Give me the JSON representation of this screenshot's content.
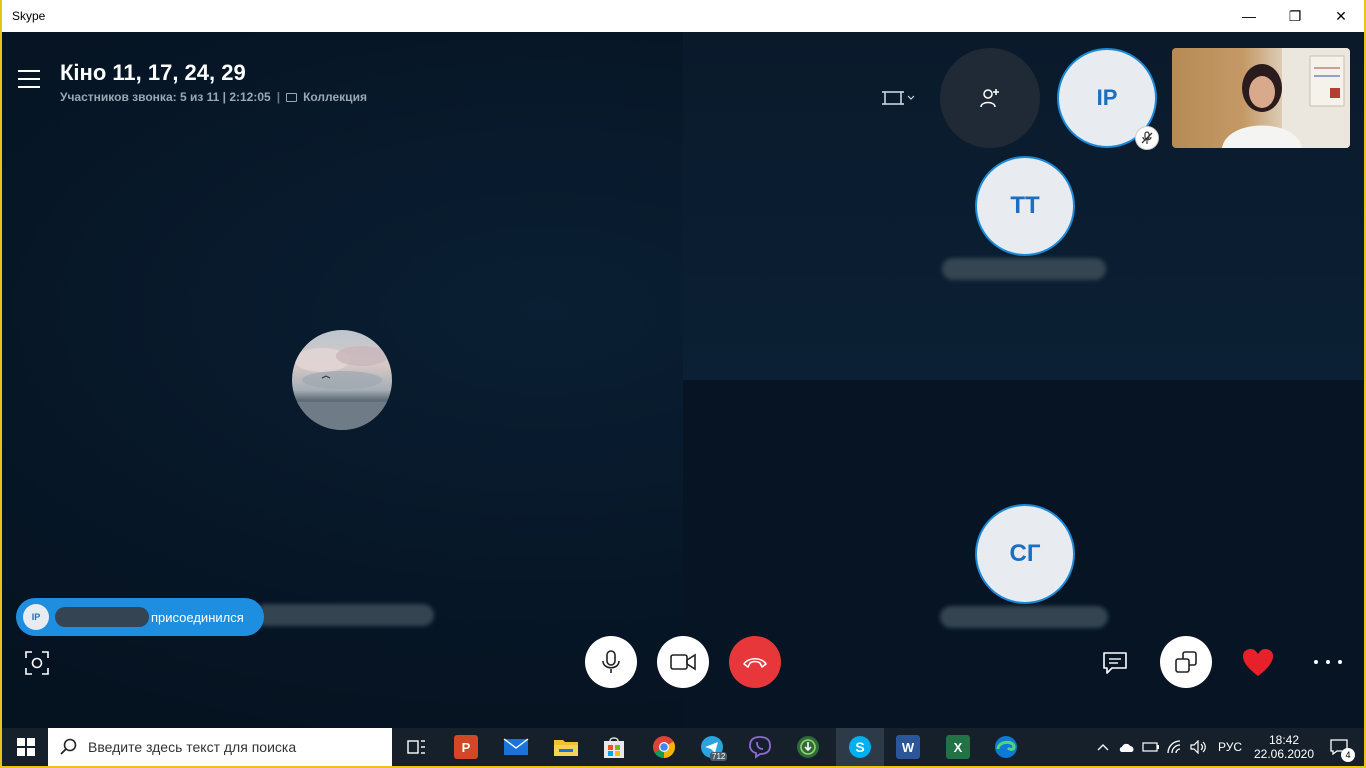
{
  "window": {
    "title": "Skype",
    "minimize": "—",
    "restore": "❐",
    "close": "✕"
  },
  "call": {
    "title": "Кіно 11, 17, 24, 29",
    "participants": "Участников звонка: 5 из 11 | 2:12:05",
    "separator": "|",
    "collection": "Коллекция"
  },
  "participants": [
    {
      "initials": "IP",
      "muted": true
    },
    {
      "initials": "TT"
    },
    {
      "initials": "СГ"
    }
  ],
  "toast": {
    "avatar": "IP",
    "text": "присоединился"
  },
  "taskbar": {
    "search_placeholder": "Введите здесь текст для поиска",
    "telegram_badge": "712",
    "lang": "РУС",
    "time": "18:42",
    "date": "22.06.2020",
    "notifications": "4"
  },
  "colors": {
    "accent": "#1a8ad6",
    "hangup": "#e8373a",
    "heart": "#e8202a",
    "border": "#e8c319"
  }
}
